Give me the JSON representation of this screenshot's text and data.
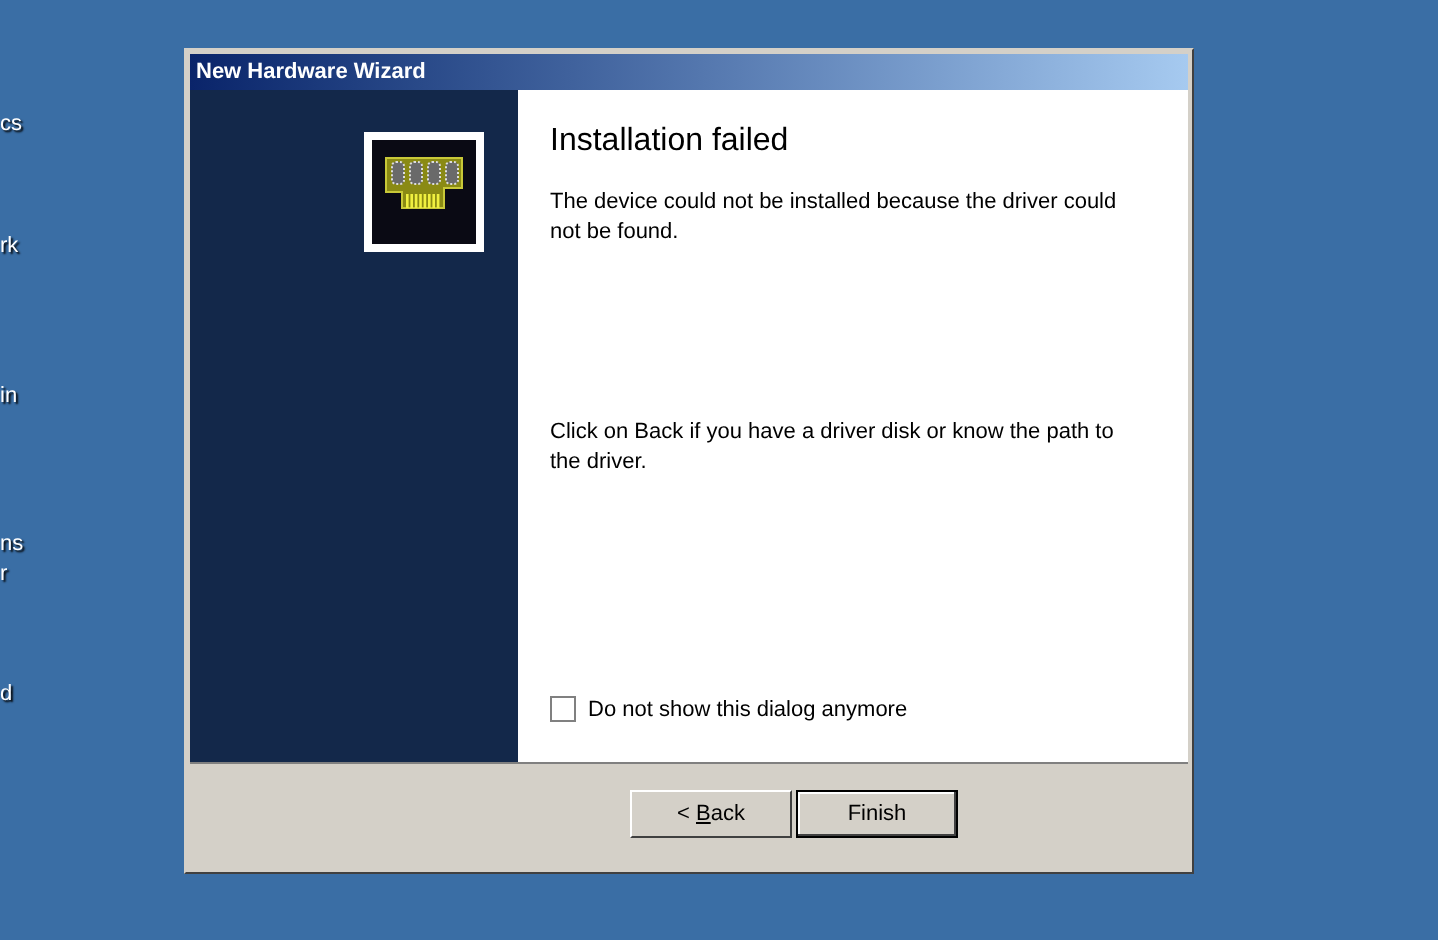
{
  "desktop_labels": [
    {
      "text": "cs"
    },
    {
      "text": "rk"
    },
    {
      "text": "in"
    },
    {
      "text": "ns"
    },
    {
      "text": "r"
    },
    {
      "text": "d"
    }
  ],
  "window": {
    "title": "New Hardware Wizard"
  },
  "heading": "Installation failed",
  "paragraphs": [
    "The device could not be installed because the driver could not be found.",
    "Click on Back if you have a driver disk or know the path to the driver."
  ],
  "checkbox": {
    "label": "Do not show this dialog anymore",
    "checked": false
  },
  "buttons": [
    {
      "label": "< ",
      "access_key": "B",
      "label_rest": "ack",
      "default": false
    },
    {
      "label": "Finish",
      "default": true
    }
  ]
}
